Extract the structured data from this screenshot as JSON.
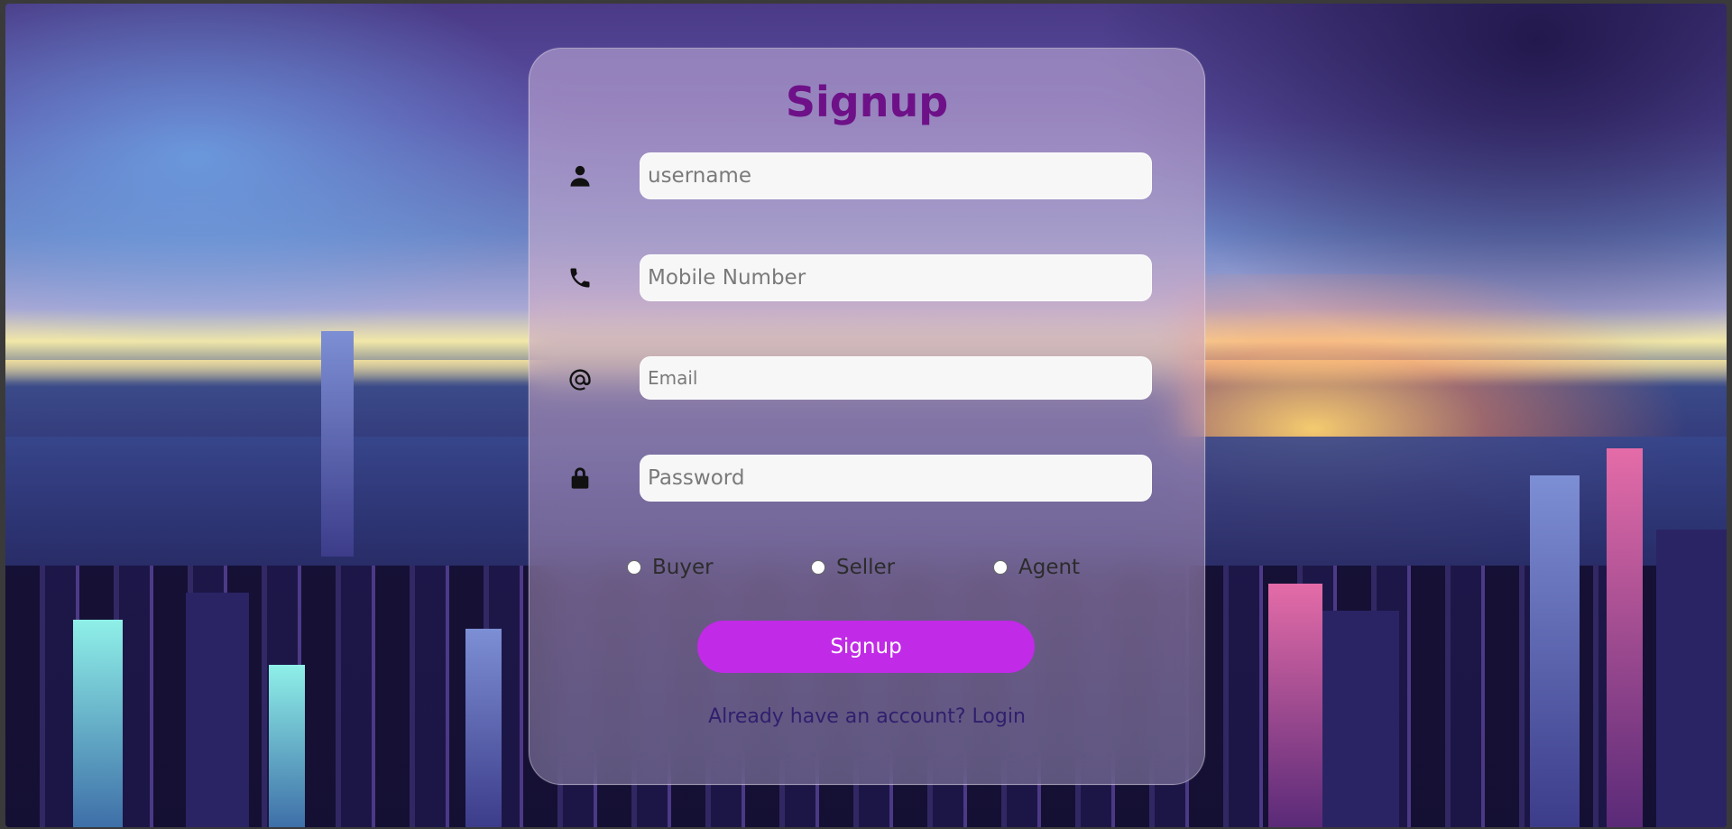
{
  "form": {
    "title": "Signup",
    "fields": {
      "username": {
        "placeholder": "username",
        "value": "",
        "icon": "user-icon"
      },
      "mobile": {
        "placeholder": "Mobile Number",
        "value": "",
        "icon": "phone-icon"
      },
      "email": {
        "placeholder": "Email",
        "value": "",
        "icon": "at-sign-icon"
      },
      "password": {
        "placeholder": "Password",
        "value": "",
        "icon": "lock-icon"
      }
    },
    "roles": [
      {
        "label": "Buyer",
        "selected": false
      },
      {
        "label": "Seller",
        "selected": false
      },
      {
        "label": "Agent",
        "selected": false
      }
    ],
    "submit_label": "Signup",
    "login_prompt": "Already have an account?",
    "login_link": "Login"
  },
  "colors": {
    "title": "#6e1188",
    "button": "#c12ae6",
    "button_text": "#ffffff",
    "login_text": "#2f1f6e"
  }
}
